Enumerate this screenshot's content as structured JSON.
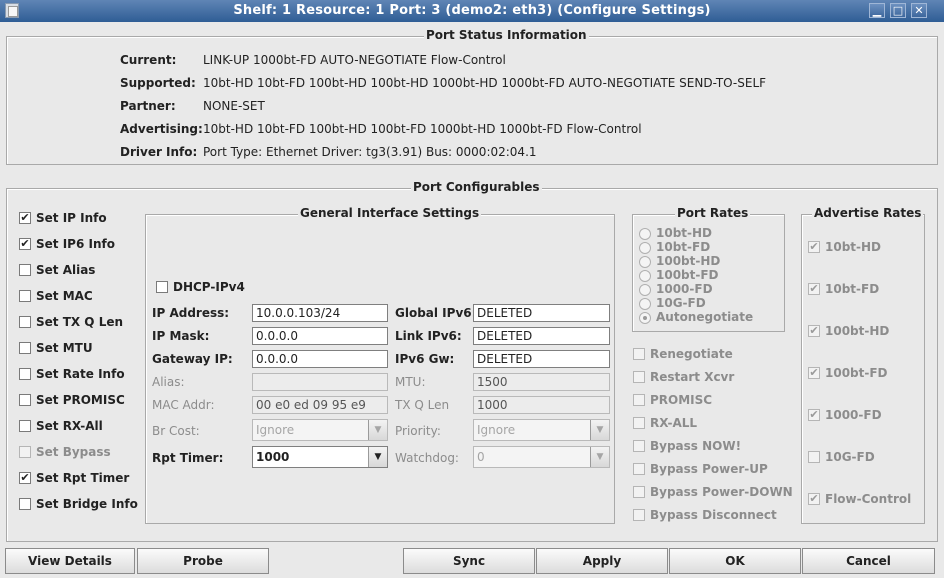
{
  "window": {
    "title": "Shelf: 1  Resource: 1  Port: 3  (demo2: eth3)  (Configure Settings)",
    "minimize_glyph": "▁",
    "maximize_glyph": "□",
    "close_glyph": "✕"
  },
  "status": {
    "legend": "Port Status Information",
    "current_label": "Current:",
    "current_value": "LINK-UP 1000bt-FD AUTO-NEGOTIATE Flow-Control",
    "supported_label": "Supported:",
    "supported_value": "10bt-HD 10bt-FD 100bt-HD 100bt-HD 1000bt-HD 1000bt-FD AUTO-NEGOTIATE SEND-TO-SELF",
    "partner_label": "Partner:",
    "partner_value": "NONE-SET",
    "advertising_label": "Advertising:",
    "advertising_value": "10bt-HD 10bt-FD 100bt-HD 100bt-FD 1000bt-HD 1000bt-FD Flow-Control",
    "driver_label": "Driver Info:",
    "driver_value": "Port Type: Ethernet   Driver: tg3(3.91)  Bus: 0000:02:04.1"
  },
  "configurables": {
    "legend": "Port Configurables",
    "left_checks": [
      {
        "label": "Set IP Info",
        "checked": true,
        "enabled": true
      },
      {
        "label": "Set IP6 Info",
        "checked": true,
        "enabled": true
      },
      {
        "label": "Set Alias",
        "checked": false,
        "enabled": true
      },
      {
        "label": "Set MAC",
        "checked": false,
        "enabled": true
      },
      {
        "label": "Set TX Q Len",
        "checked": false,
        "enabled": true
      },
      {
        "label": "Set MTU",
        "checked": false,
        "enabled": true
      },
      {
        "label": "Set Rate Info",
        "checked": false,
        "enabled": true
      },
      {
        "label": "Set PROMISC",
        "checked": false,
        "enabled": true
      },
      {
        "label": "Set RX-All",
        "checked": false,
        "enabled": true
      },
      {
        "label": "Set Bypass",
        "checked": false,
        "enabled": false
      },
      {
        "label": "Set Rpt Timer",
        "checked": true,
        "enabled": true
      },
      {
        "label": "Set Bridge Info",
        "checked": false,
        "enabled": true
      }
    ]
  },
  "general": {
    "legend": "General Interface Settings",
    "dhcp_label": "DHCP-IPv4",
    "dhcp_checked": false,
    "ip_address_label": "IP Address:",
    "ip_address_value": "10.0.0.103/24",
    "ip_mask_label": "IP Mask:",
    "ip_mask_value": "0.0.0.0",
    "gateway_label": "Gateway IP:",
    "gateway_value": "0.0.0.0",
    "alias_label": "Alias:",
    "alias_value": "",
    "mac_label": "MAC Addr:",
    "mac_value": "00 e0 ed 09 95 e9",
    "brcost_label": "Br Cost:",
    "brcost_value": "Ignore",
    "rpt_label": "Rpt Timer:",
    "rpt_value": "1000",
    "global_ipv6_label": "Global IPv6:",
    "global_ipv6_value": "DELETED",
    "link_ipv6_label": "Link IPv6:",
    "link_ipv6_value": "DELETED",
    "ipv6_gw_label": "IPv6 Gw:",
    "ipv6_gw_value": "DELETED",
    "mtu_label": "MTU:",
    "mtu_value": "1500",
    "txq_label": "TX Q Len",
    "txq_value": "1000",
    "priority_label": "Priority:",
    "priority_value": "Ignore",
    "watchdog_label": "Watchdog:",
    "watchdog_value": "0"
  },
  "port_rates": {
    "legend": "Port Rates",
    "options": [
      {
        "label": "10bt-HD",
        "selected": false
      },
      {
        "label": "10bt-FD",
        "selected": false
      },
      {
        "label": "100bt-HD",
        "selected": false
      },
      {
        "label": "100bt-FD",
        "selected": false
      },
      {
        "label": "1000-FD",
        "selected": false
      },
      {
        "label": "10G-FD",
        "selected": false
      },
      {
        "label": "Autonegotiate",
        "selected": true
      }
    ],
    "extra_checks": [
      {
        "label": "Renegotiate",
        "checked": false
      },
      {
        "label": "Restart Xcvr",
        "checked": false
      },
      {
        "label": "PROMISC",
        "checked": false
      },
      {
        "label": "RX-ALL",
        "checked": false
      },
      {
        "label": "Bypass NOW!",
        "checked": false
      },
      {
        "label": "Bypass Power-UP",
        "checked": false
      },
      {
        "label": "Bypass Power-DOWN",
        "checked": false
      },
      {
        "label": "Bypass Disconnect",
        "checked": false
      }
    ]
  },
  "advertise": {
    "legend": "Advertise Rates",
    "options": [
      {
        "label": "10bt-HD",
        "checked": true
      },
      {
        "label": "10bt-FD",
        "checked": true
      },
      {
        "label": "100bt-HD",
        "checked": true
      },
      {
        "label": "100bt-FD",
        "checked": true
      },
      {
        "label": "1000-FD",
        "checked": true
      },
      {
        "label": "10G-FD",
        "checked": false
      },
      {
        "label": "Flow-Control",
        "checked": true
      }
    ]
  },
  "buttons": {
    "view_details": "View Details",
    "probe": "Probe",
    "sync": "Sync",
    "apply": "Apply",
    "ok": "OK",
    "cancel": "Cancel"
  },
  "glyphs": {
    "check": "✔",
    "dropdown": "▼"
  }
}
